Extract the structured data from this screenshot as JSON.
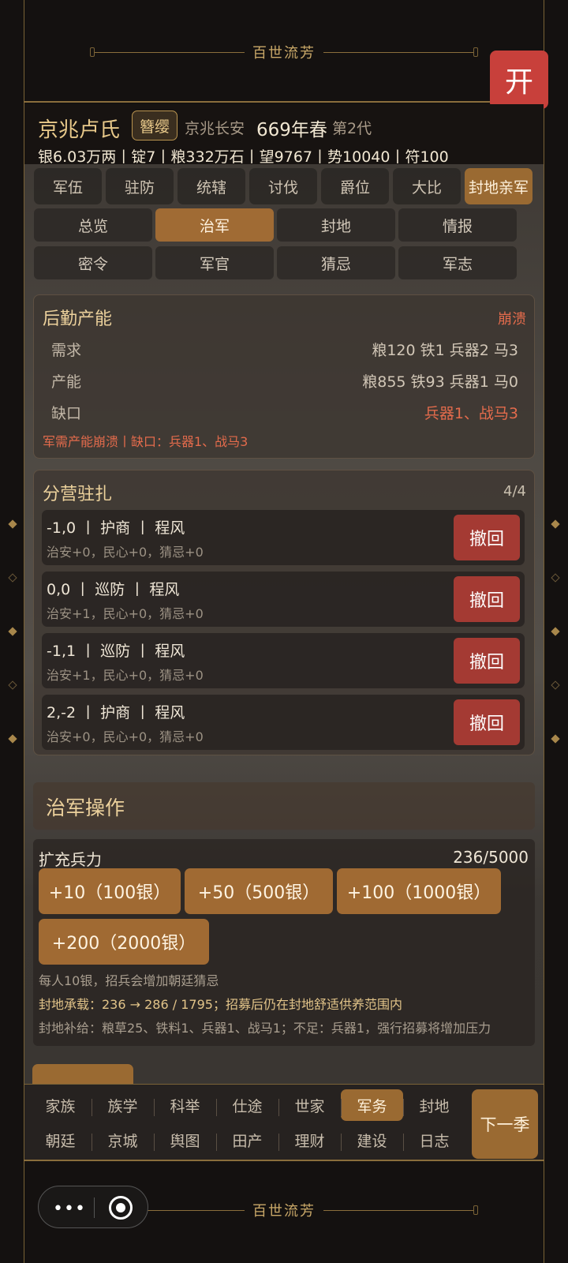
{
  "app": {
    "banner_title": "百世流芳",
    "open_button": "开"
  },
  "header": {
    "clan_name": "京兆卢氏",
    "rank_badge": "簪缨",
    "location": "京兆长安",
    "year_season": "669年春",
    "generation": "第2代",
    "stats_line": "银6.03万两丨锭7丨粮332万石丨望9767丨势10040丨符100"
  },
  "tabs_primary": [
    {
      "label": "军伍",
      "active": false
    },
    {
      "label": "驻防",
      "active": false
    },
    {
      "label": "统辖",
      "active": false
    },
    {
      "label": "讨伐",
      "active": false
    },
    {
      "label": "爵位",
      "active": false
    },
    {
      "label": "大比",
      "active": false
    },
    {
      "label": "封地亲军",
      "active": true
    }
  ],
  "tabs_secondary": [
    {
      "label": "总览",
      "active": false
    },
    {
      "label": "治军",
      "active": true
    },
    {
      "label": "封地",
      "active": false
    },
    {
      "label": "情报",
      "active": false
    },
    {
      "label": "密令",
      "active": false
    },
    {
      "label": "军官",
      "active": false
    },
    {
      "label": "猜忌",
      "active": false
    },
    {
      "label": "军志",
      "active": false
    }
  ],
  "logistics": {
    "title": "后勤产能",
    "status": "崩溃",
    "rows": [
      {
        "key": "需求",
        "value": "粮120 铁1 兵器2 马3"
      },
      {
        "key": "产能",
        "value": "粮855 铁93 兵器1 马0"
      },
      {
        "key": "缺口",
        "value": "兵器1、战马3"
      }
    ],
    "note": "军需产能崩溃丨缺口：兵器1、战马3"
  },
  "camps": {
    "title": "分营驻扎",
    "count": "4/4",
    "recall_label": "撤回",
    "items": [
      {
        "main": "-1,0 丨 护商 丨 程风",
        "sub": "治安+0，民心+0，猜忌+0"
      },
      {
        "main": "0,0 丨 巡防 丨 程风",
        "sub": "治安+1，民心+0，猜忌+0"
      },
      {
        "main": "-1,1 丨 巡防 丨 程风",
        "sub": "治安+1，民心+0，猜忌+0"
      },
      {
        "main": "2,-2 丨 护商 丨 程风",
        "sub": "治安+0，民心+0，猜忌+0"
      }
    ]
  },
  "operations": {
    "title": "治军操作"
  },
  "expand": {
    "title": "扩充兵力",
    "count": "236/5000",
    "buttons": [
      "+10（100银）",
      "+50（500银）",
      "+100（1000银）",
      "+200（2000银）"
    ],
    "note1": "每人10银，招兵会增加朝廷猜忌",
    "note2": "封地承载：236 → 286 / 1795；招募后仍在封地舒适供养范围内",
    "note3": "封地补给：粮草25、铁料1、兵器1、战马1；不足：兵器1，强行招募将增加压力"
  },
  "bottom_nav": {
    "row1": [
      {
        "label": "家族",
        "active": false
      },
      {
        "label": "族学",
        "active": false
      },
      {
        "label": "科举",
        "active": false
      },
      {
        "label": "仕途",
        "active": false
      },
      {
        "label": "世家",
        "active": false
      },
      {
        "label": "军务",
        "active": true
      },
      {
        "label": "封地",
        "active": false
      }
    ],
    "row2": [
      {
        "label": "朝廷",
        "active": false
      },
      {
        "label": "京城",
        "active": false
      },
      {
        "label": "舆图",
        "active": false
      },
      {
        "label": "田产",
        "active": false
      },
      {
        "label": "理财",
        "active": false
      },
      {
        "label": "建设",
        "active": false
      },
      {
        "label": "日志",
        "active": false
      }
    ],
    "next_season": "下一季"
  },
  "colors": {
    "accent": "#9a6a32",
    "danger": "#a43a33",
    "warning_text": "#e36b4c",
    "gold_text": "#ecd19c"
  }
}
